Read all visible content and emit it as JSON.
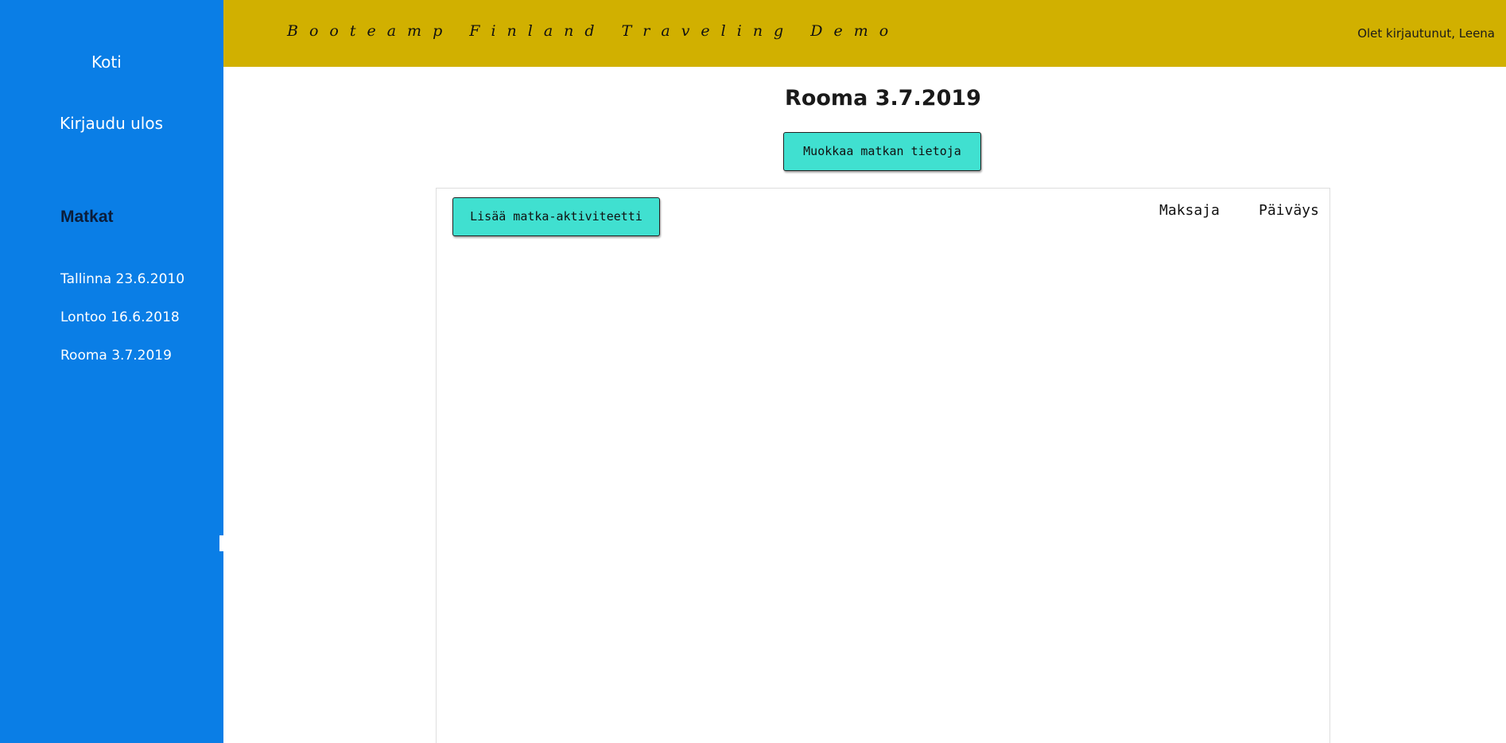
{
  "header": {
    "brand": "Booteamp Finland Traveling Demo",
    "login_prefix": "Olet kirjautunut, ",
    "user_name": "Leena"
  },
  "sidebar": {
    "home_label": "Koti",
    "logout_label": "Kirjaudu ulos",
    "trips_heading": "Matkat",
    "trips": [
      {
        "label": "Tallinna 23.6.2010"
      },
      {
        "label": "Lontoo 16.6.2018"
      },
      {
        "label": "Rooma 3.7.2019"
      }
    ]
  },
  "main": {
    "title": "Rooma 3.7.2019",
    "edit_button_label": "Muokkaa matkan tietoja",
    "add_activity_label": "Lisää matka-aktiviteetti",
    "columns": [
      "Maksaja",
      "Päiväys"
    ]
  },
  "colors": {
    "sidebar": "#0a7ee6",
    "topbar": "#d1b000",
    "button": "#40e0d0"
  }
}
